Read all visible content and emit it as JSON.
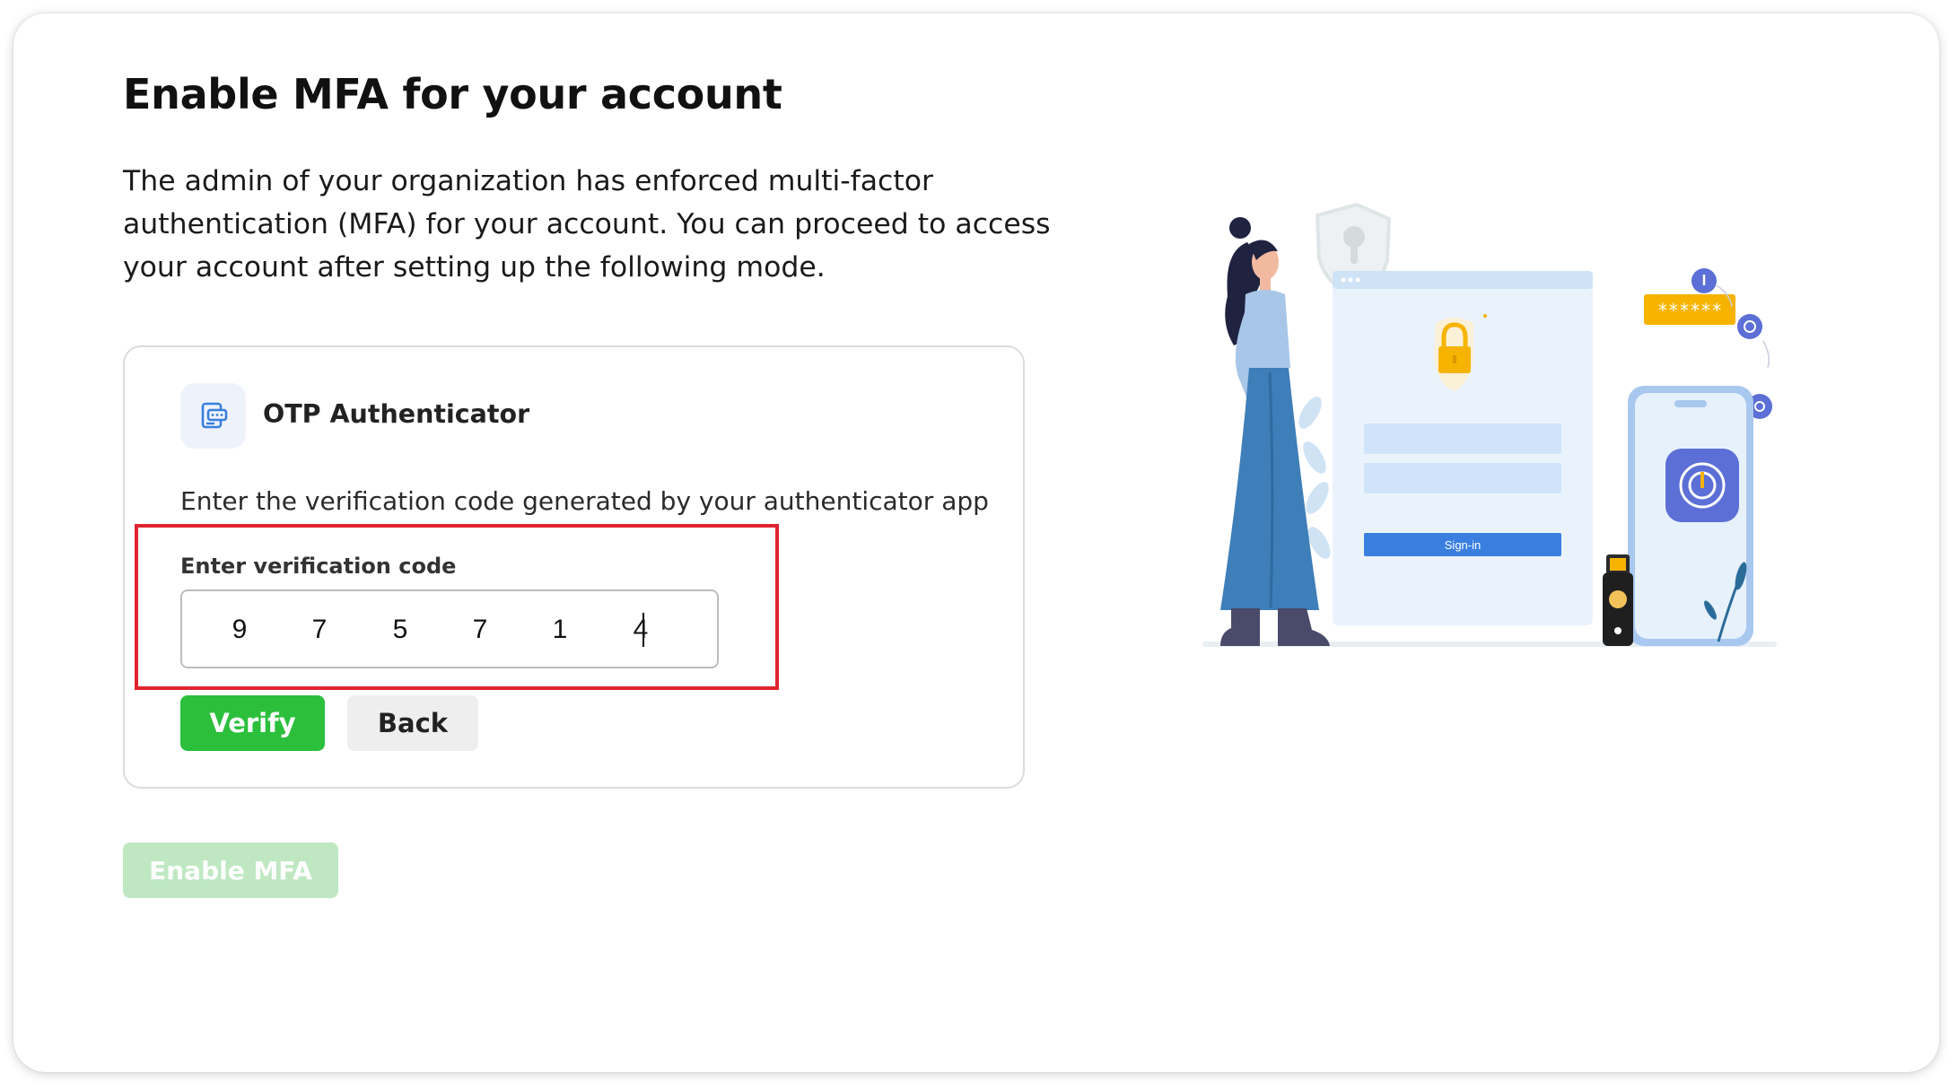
{
  "page": {
    "title": "Enable MFA for your account",
    "description": "The admin of your organization has enforced multi-factor authentication (MFA) for your account. You can proceed to access your account after setting up the following mode."
  },
  "otp_panel": {
    "icon": "authenticator-app-icon",
    "title": "OTP Authenticator",
    "instruction": "Enter the verification code generated by your authenticator app",
    "field_label": "Enter verification code",
    "code_digits": [
      "9",
      "7",
      "5",
      "7",
      "1",
      "4"
    ],
    "verify_label": "Verify",
    "back_label": "Back"
  },
  "enable_button_label": "Enable MFA",
  "illustration": {
    "signin_button_label": "Sign-in",
    "password_mask": "******"
  },
  "colors": {
    "primary_green": "#2bbf3c",
    "disabled_green": "#bfe8c2",
    "highlight_red": "#e0242f",
    "accent_blue": "#3a7fe0"
  }
}
